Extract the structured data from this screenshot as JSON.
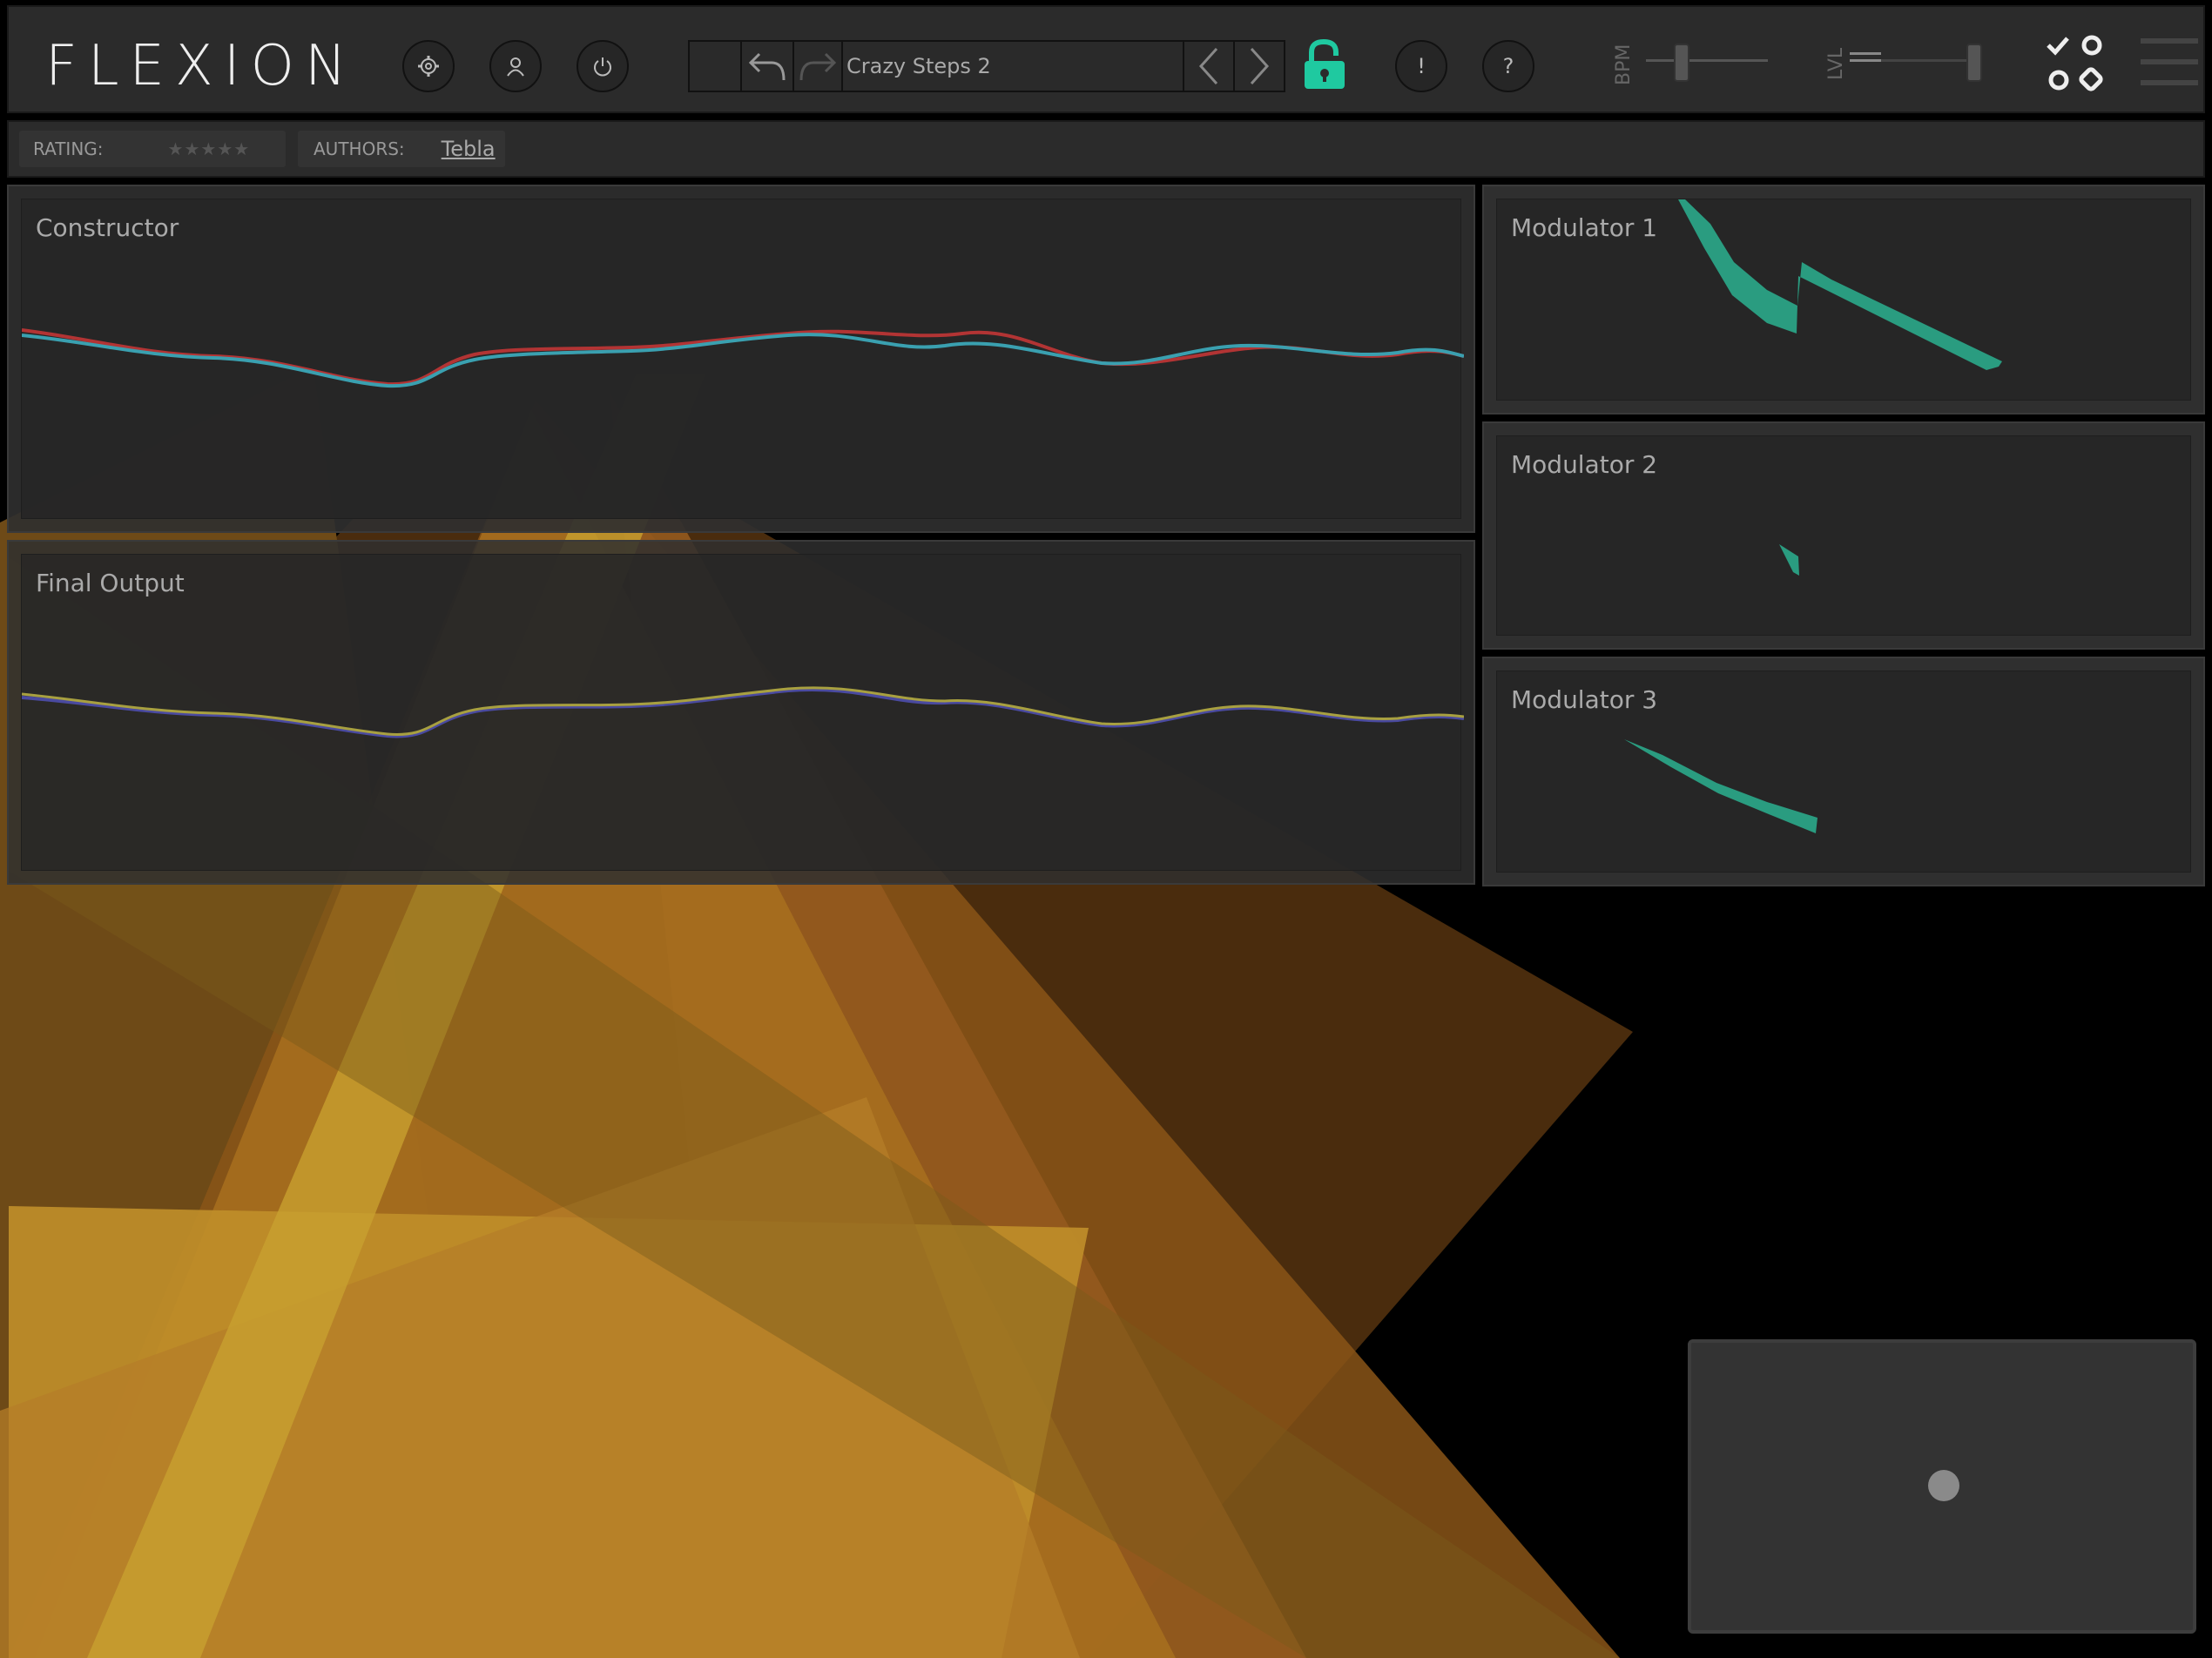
{
  "app": {
    "logo": "FLEXION"
  },
  "toolbar": {
    "preset_name": "Crazy Steps 2",
    "alert_label": "!",
    "help_label": "?",
    "bpm_label": "BPM",
    "lvl_label": "LVL"
  },
  "info": {
    "rating_label": "RATING:",
    "rating_stars": "★★★★★",
    "authors_label": "AUTHORS:",
    "author": "Tebla"
  },
  "panels": {
    "constructor": "Constructor",
    "final_output": "Final Output",
    "modulator1": "Modulator 1",
    "modulator2": "Modulator 2",
    "modulator3": "Modulator 3"
  },
  "colors": {
    "accent": "#1fc9a0",
    "mod_fill": "#2a9c80",
    "curve_red": "#b23434",
    "curve_teal": "#3aa0b0",
    "curve_yellow": "#a8a040",
    "curve_blue": "#4a4aa0"
  },
  "icons": [
    "settings-gear-icon",
    "user-icon",
    "power-icon",
    "undo-icon",
    "redo-icon",
    "chevron-left-icon",
    "chevron-right-icon",
    "unlock-icon",
    "shapes-icon",
    "menu-icon"
  ]
}
